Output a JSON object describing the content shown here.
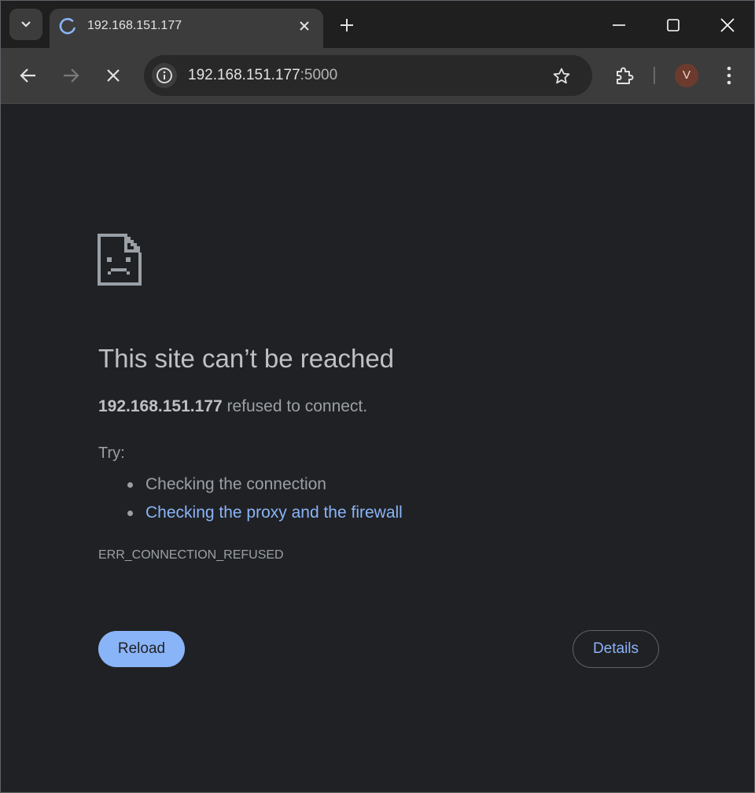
{
  "tab": {
    "title": "192.168.151.177"
  },
  "toolbar": {
    "url_host": "192.168.151.177",
    "url_port": ":5000",
    "avatar_initial": "V"
  },
  "icons": {
    "tab_search": "chevron-down-icon",
    "tab_loading": "loading-spinner-icon",
    "tab_close": "close-icon",
    "new_tab": "plus-icon",
    "minimize": "minimize-icon",
    "maximize": "maximize-icon",
    "close_window": "close-icon",
    "back": "arrow-left-icon",
    "forward": "arrow-right-icon",
    "stop": "close-icon",
    "site_info": "info-icon",
    "bookmark": "star-icon",
    "extensions": "puzzle-icon",
    "menu": "kebab-menu-icon",
    "error": "sad-page-icon"
  },
  "error_page": {
    "heading": "This site can’t be reached",
    "host": "192.168.151.177",
    "message": " refused to connect.",
    "try_label": "Try:",
    "suggestions": [
      "Checking the connection",
      "Checking the proxy and the firewall"
    ],
    "error_code": "ERR_CONNECTION_REFUSED",
    "reload_label": "Reload",
    "details_label": "Details"
  },
  "colors": {
    "background": "#202124",
    "toolbar": "#3c3c3c",
    "accent": "#8ab4f8",
    "heading_text": "#bdc1c6",
    "body_text": "#9aa0a6"
  }
}
